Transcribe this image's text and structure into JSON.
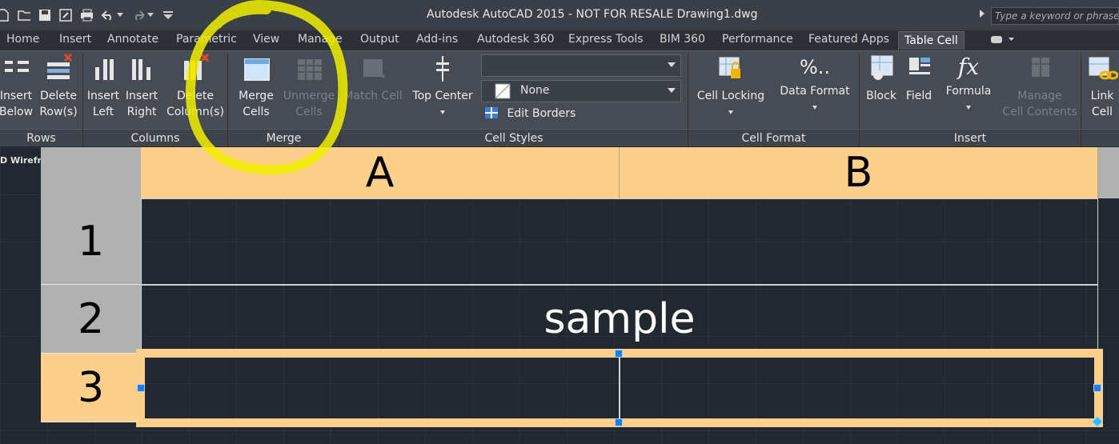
{
  "window": {
    "title": "Autodesk AutoCAD 2015 - NOT FOR RESALE    Drawing1.dwg",
    "search_placeholder": "Type a keyword or phrase"
  },
  "quick_access": [
    "new-icon",
    "open-icon",
    "save-icon",
    "saveas-icon",
    "print-icon",
    "undo-icon",
    "redo-icon",
    "customize-icon"
  ],
  "tabs": [
    "Home",
    "Insert",
    "Annotate",
    "Parametric",
    "View",
    "Manage",
    "Output",
    "Add-ins",
    "Autodesk 360",
    "Express Tools",
    "BIM 360",
    "Performance",
    "Featured Apps",
    "Table Cell"
  ],
  "active_tab": "Table Cell",
  "ribbon": {
    "rows": {
      "label": "Rows",
      "insert_below": [
        "Insert",
        "Below"
      ],
      "delete_rows": [
        "Delete",
        "Row(s)"
      ]
    },
    "columns": {
      "label": "Columns",
      "insert_left": [
        "Insert",
        "Left"
      ],
      "insert_right": [
        "Insert",
        "Right"
      ],
      "delete_cols": [
        "Delete",
        "Column(s)"
      ]
    },
    "merge": {
      "label": "Merge",
      "merge_cells": [
        "Merge",
        "Cells"
      ],
      "unmerge_cells": [
        "Unmerge",
        "Cells"
      ]
    },
    "cell_styles": {
      "label": "Cell Styles",
      "match_cell": "Match Cell",
      "top_center": "Top Center",
      "style_combo": "",
      "fill_combo": "None",
      "edit_borders": "Edit Borders"
    },
    "cell_format": {
      "label": "Cell Format",
      "cell_locking": "Cell Locking",
      "data_format": "Data Format",
      "data_format_glyph": "%.."
    },
    "insert": {
      "label": "Insert",
      "block": "Block",
      "field": "Field",
      "formula": "Formula",
      "formula_glyph": "fx",
      "manage_cell": [
        "Manage",
        "Cell Contents"
      ]
    },
    "data": {
      "link_cell": [
        "Link",
        "Cell"
      ]
    }
  },
  "viewport_label": "D Wireframe]",
  "table": {
    "columns": [
      "A",
      "B"
    ],
    "rows": [
      "1",
      "2",
      "3"
    ],
    "cells": {
      "row2_merged": "sample"
    }
  },
  "colors": {
    "highlight": "#fcd08a",
    "annotation_circle": "#f2f000",
    "grip": "#1e7ee8"
  }
}
